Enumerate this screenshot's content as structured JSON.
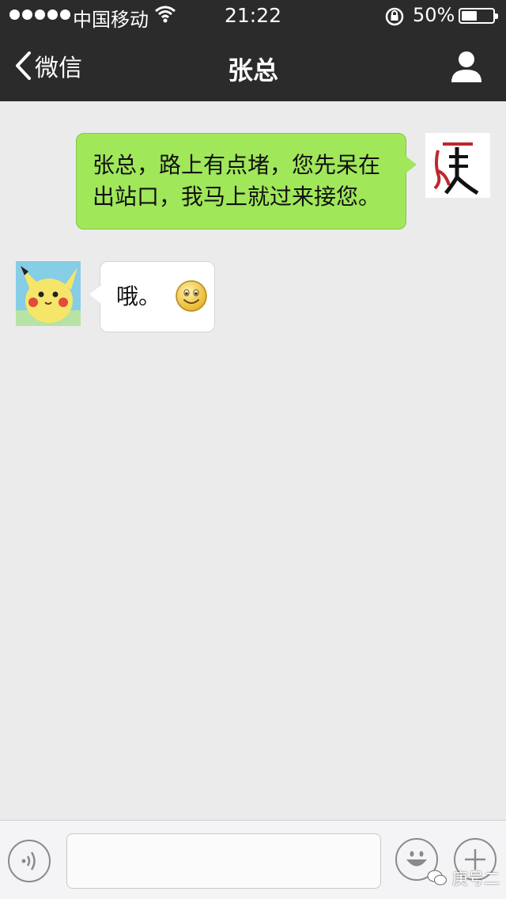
{
  "status_bar": {
    "carrier": "中国移动",
    "time": "21:22",
    "battery": "50%",
    "battery_level": 0.5
  },
  "nav": {
    "back_label": "微信",
    "title": "张总",
    "profile_icon": "person-icon"
  },
  "messages": [
    {
      "side": "sent",
      "text_line1": "张总，路上有点堵，您先呆在",
      "text_line2": "出站口，我马上就过来接您。",
      "avatar_glyph": "庚"
    },
    {
      "side": "received",
      "text": "哦。",
      "emoji": "smile-emoji",
      "avatar": "pikachu-avatar"
    }
  ],
  "input_bar": {
    "voice_icon": "voice-icon",
    "emoji_icon": "emoji-icon",
    "plus_icon": "plus-icon",
    "input_value": ""
  },
  "watermark": {
    "text": "庚号二"
  },
  "colors": {
    "header_bg": "#2b2b2b",
    "chat_bg": "#ebebeb",
    "sent_bubble": "#a0e75a",
    "received_bubble": "#ffffff"
  }
}
